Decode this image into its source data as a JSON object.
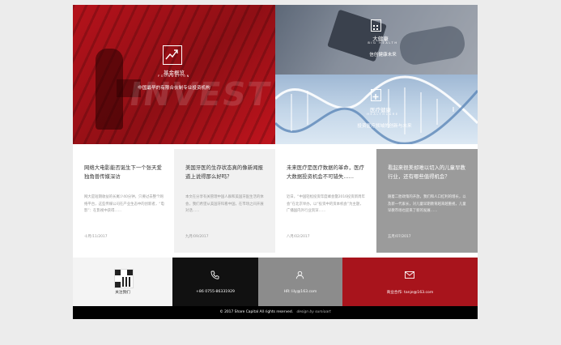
{
  "hero": {
    "foundation": {
      "title": "基金概览",
      "subtitle": "FOUNDATION",
      "description": "中国最早的有限合伙制专业投资机构",
      "bg_word": "INVEST"
    },
    "big_health": {
      "title": "大健康",
      "subtitle": "BIG HEALTH",
      "description": "信创健康未来"
    },
    "healthcare": {
      "title": "医疗健康",
      "subtitle": "HEALTHCARE",
      "description": "投资医疗领域的创新与未来"
    }
  },
  "articles": [
    {
      "title": "网络大电影能否诞生下一个张天爱 独角兽传媒深访",
      "excerpt": "网大是短期收益的长尾少40分钟，只要过去整个网络平台，这些传媒公司在产业生态中的创新者，“电影”：在影视中获得……",
      "date": "十月/11/2017"
    },
    {
      "title": "美国牙医的生存状态真的像新闻报道上说得那么好吗？",
      "excerpt": "本文在分享有关管理中国人群和美国牙医生活的体会，我们希望从美国牙科看中国，在市场之间开展对话……",
      "date": "九月/09/2017"
    },
    {
      "title": "未来医疗是医疗数据的革命，医疗大数据投资机会不可错失……",
      "excerpt": "近日，“中国轻松投资年度峰会暨2016投资新周年会”在北京举办，以“投资中的资本机会”为主题，广播国内外行业资深……",
      "date": "八月/02/2017"
    },
    {
      "title": "看起来很美却难以切入的儿童早教行业，还有哪些值得机会？",
      "excerpt": "随着二胎政策的开放，我们和人口红利的增长，以及新一代家长，对儿童早期教育越来越重视，儿童早教市场也迎来了新的发展……",
      "date": "五月/07/2017"
    }
  ],
  "contact": {
    "follow": "关注我们",
    "phone": "+86 0755-86331929",
    "hr": "HR: lily@163.com",
    "business": "商业合作: tanje@163.com"
  },
  "footer": {
    "copyright": "© 2017 Share Capital All rights reserved.",
    "design": "design by sumiaart"
  },
  "colors": {
    "brand_red": "#b5121b",
    "dark": "#111111",
    "mid_gray": "#9b9b9b"
  }
}
